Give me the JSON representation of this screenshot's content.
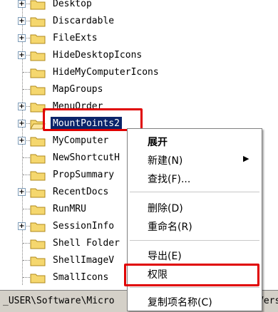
{
  "tree": {
    "items": [
      {
        "label": "Desktop",
        "expander": "+"
      },
      {
        "label": "Discardable",
        "expander": "+"
      },
      {
        "label": "FileExts",
        "expander": "+"
      },
      {
        "label": "HideDesktopIcons",
        "expander": "+"
      },
      {
        "label": "HideMyComputerIcons",
        "expander": ""
      },
      {
        "label": "MapGroups",
        "expander": ""
      },
      {
        "label": "MenuOrder",
        "expander": "+"
      },
      {
        "label": "MountPoints2",
        "expander": "+",
        "selected": true
      },
      {
        "label": "MyComputer",
        "expander": "+"
      },
      {
        "label": "NewShortcutH",
        "expander": ""
      },
      {
        "label": "PropSummary",
        "expander": ""
      },
      {
        "label": "RecentDocs",
        "expander": "+"
      },
      {
        "label": "RunMRU",
        "expander": ""
      },
      {
        "label": "SessionInfo",
        "expander": "+"
      },
      {
        "label": "Shell Folder",
        "expander": ""
      },
      {
        "label": "ShellImageV",
        "expander": ""
      },
      {
        "label": "SmallIcons",
        "expander": ""
      }
    ]
  },
  "status_bar": {
    "path_left": "_USER\\Software\\Micro",
    "path_right": "Vers"
  },
  "context_menu": {
    "expand": "展开",
    "new": "新建(N)",
    "new_arrow": "▶",
    "find": "查找(F)...",
    "delete": "删除(D)",
    "rename": "重命名(R)",
    "export": "导出(E)",
    "permissions": "权限",
    "copy_key_name": "复制项名称(C)"
  },
  "colors": {
    "selection": "#0a246a",
    "highlight_box": "#e00000",
    "folder": "#f5d76e"
  }
}
